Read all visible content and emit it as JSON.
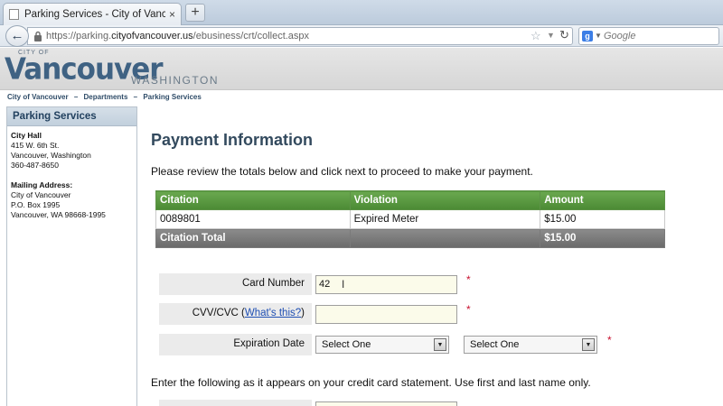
{
  "browser": {
    "tab_title": "Parking Services - City of Vancouver, Wa...",
    "tab_close": "×",
    "new_tab": "+",
    "back": "←",
    "url_prefix": "https://parking.",
    "url_domain": "cityofvancouver.us",
    "url_path": "/ebusiness/crt/collect.aspx",
    "search_placeholder": "Google",
    "search_engine_letter": "g",
    "icons": [
      "lock-icon",
      "star-icon",
      "reload-icon",
      "google-icon"
    ]
  },
  "site": {
    "logo_small": "CITY OF",
    "logo_main": "Vancouver",
    "logo_state": "WASHINGTON",
    "logo_color": "#3f6283"
  },
  "breadcrumb": [
    "City of Vancouver",
    "–",
    "Departments",
    "–",
    "Parking Services"
  ],
  "sidebar": {
    "title": "Parking Services",
    "city_hall": {
      "heading": "City Hall",
      "lines": [
        "415 W. 6th St.",
        "Vancouver, Washington",
        "360-487-8650"
      ]
    },
    "mailing": {
      "heading": "Mailing Address:",
      "lines": [
        "City of Vancouver",
        "P.O. Box 1995",
        "Vancouver, WA 98668-1995"
      ]
    }
  },
  "main": {
    "title": "Payment Information",
    "intro": "Please review the totals below and click next to proceed to make your payment.",
    "table": {
      "headers": [
        "Citation",
        "Violation",
        "Amount"
      ],
      "rows": [
        [
          "0089801",
          "Expired Meter",
          "$15.00"
        ]
      ],
      "total_label": "Citation Total",
      "total_amount": "$15.00",
      "header_color": "#5a9a41"
    },
    "form": {
      "card_number_label": "Card Number",
      "card_number_value": "42",
      "cvv_label_prefix": "CVV/CVC (",
      "cvv_link": "What's this?",
      "cvv_label_suffix": ")",
      "expiration_label": "Expiration Date",
      "month_select": "Select One",
      "year_select": "Select One",
      "required_marker": "*"
    },
    "cc_note": "Enter the following as it appears on your credit card statement. Use first and last name only."
  }
}
